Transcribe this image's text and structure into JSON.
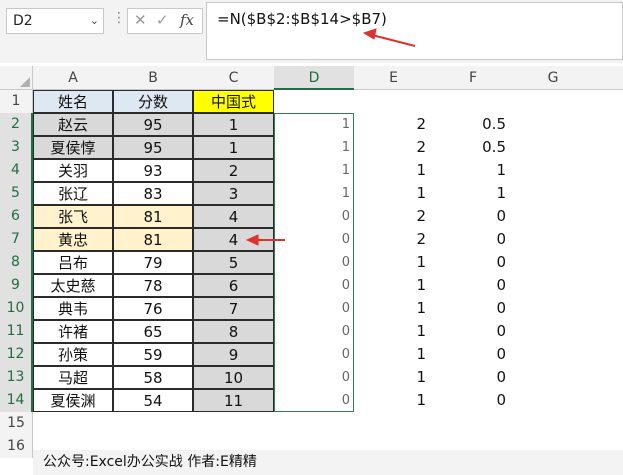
{
  "namebox": {
    "value": "D2"
  },
  "toolbar": {
    "cancel_icon": "✕",
    "enter_icon": "✓",
    "fx_label": "fx"
  },
  "formula": {
    "value": "=N($B$2:$B$14>$B7)"
  },
  "columns": [
    "A",
    "B",
    "C",
    "D",
    "E",
    "F",
    "G"
  ],
  "rows": [
    "1",
    "2",
    "3",
    "4",
    "5",
    "6",
    "7",
    "8",
    "9",
    "10",
    "11",
    "12",
    "13",
    "14",
    "15",
    "16"
  ],
  "headers": {
    "name": "姓名",
    "score": "分数",
    "china_style": "中国式"
  },
  "data": [
    {
      "name": "赵云",
      "score": "95",
      "rank": "1",
      "d": "1",
      "e": "2",
      "f": "0.5"
    },
    {
      "name": "夏侯惇",
      "score": "95",
      "rank": "1",
      "d": "1",
      "e": "2",
      "f": "0.5"
    },
    {
      "name": "关羽",
      "score": "93",
      "rank": "2",
      "d": "1",
      "e": "1",
      "f": "1"
    },
    {
      "name": "张辽",
      "score": "83",
      "rank": "3",
      "d": "1",
      "e": "1",
      "f": "1"
    },
    {
      "name": "张飞",
      "score": "81",
      "rank": "4",
      "d": "0",
      "e": "2",
      "f": "0"
    },
    {
      "name": "黄忠",
      "score": "81",
      "rank": "4",
      "d": "0",
      "e": "2",
      "f": "0"
    },
    {
      "name": "吕布",
      "score": "79",
      "rank": "5",
      "d": "0",
      "e": "1",
      "f": "0"
    },
    {
      "name": "太史慈",
      "score": "78",
      "rank": "6",
      "d": "0",
      "e": "1",
      "f": "0"
    },
    {
      "name": "典韦",
      "score": "76",
      "rank": "7",
      "d": "0",
      "e": "1",
      "f": "0"
    },
    {
      "name": "许褚",
      "score": "65",
      "rank": "8",
      "d": "0",
      "e": "1",
      "f": "0"
    },
    {
      "name": "孙策",
      "score": "59",
      "rank": "9",
      "d": "0",
      "e": "1",
      "f": "0"
    },
    {
      "name": "马超",
      "score": "58",
      "rank": "10",
      "d": "0",
      "e": "1",
      "f": "0"
    },
    {
      "name": "夏侯渊",
      "score": "54",
      "rank": "11",
      "d": "0",
      "e": "1",
      "f": "0"
    }
  ],
  "footer": {
    "text": "公众号:Excel办公实战 作者:E精精"
  },
  "colors": {
    "header_blue": "#dde8f3",
    "gray": "#d9d9d9",
    "yellow": "#ffff00",
    "highlight": "#fff2cc",
    "arrow": "#e03030"
  }
}
